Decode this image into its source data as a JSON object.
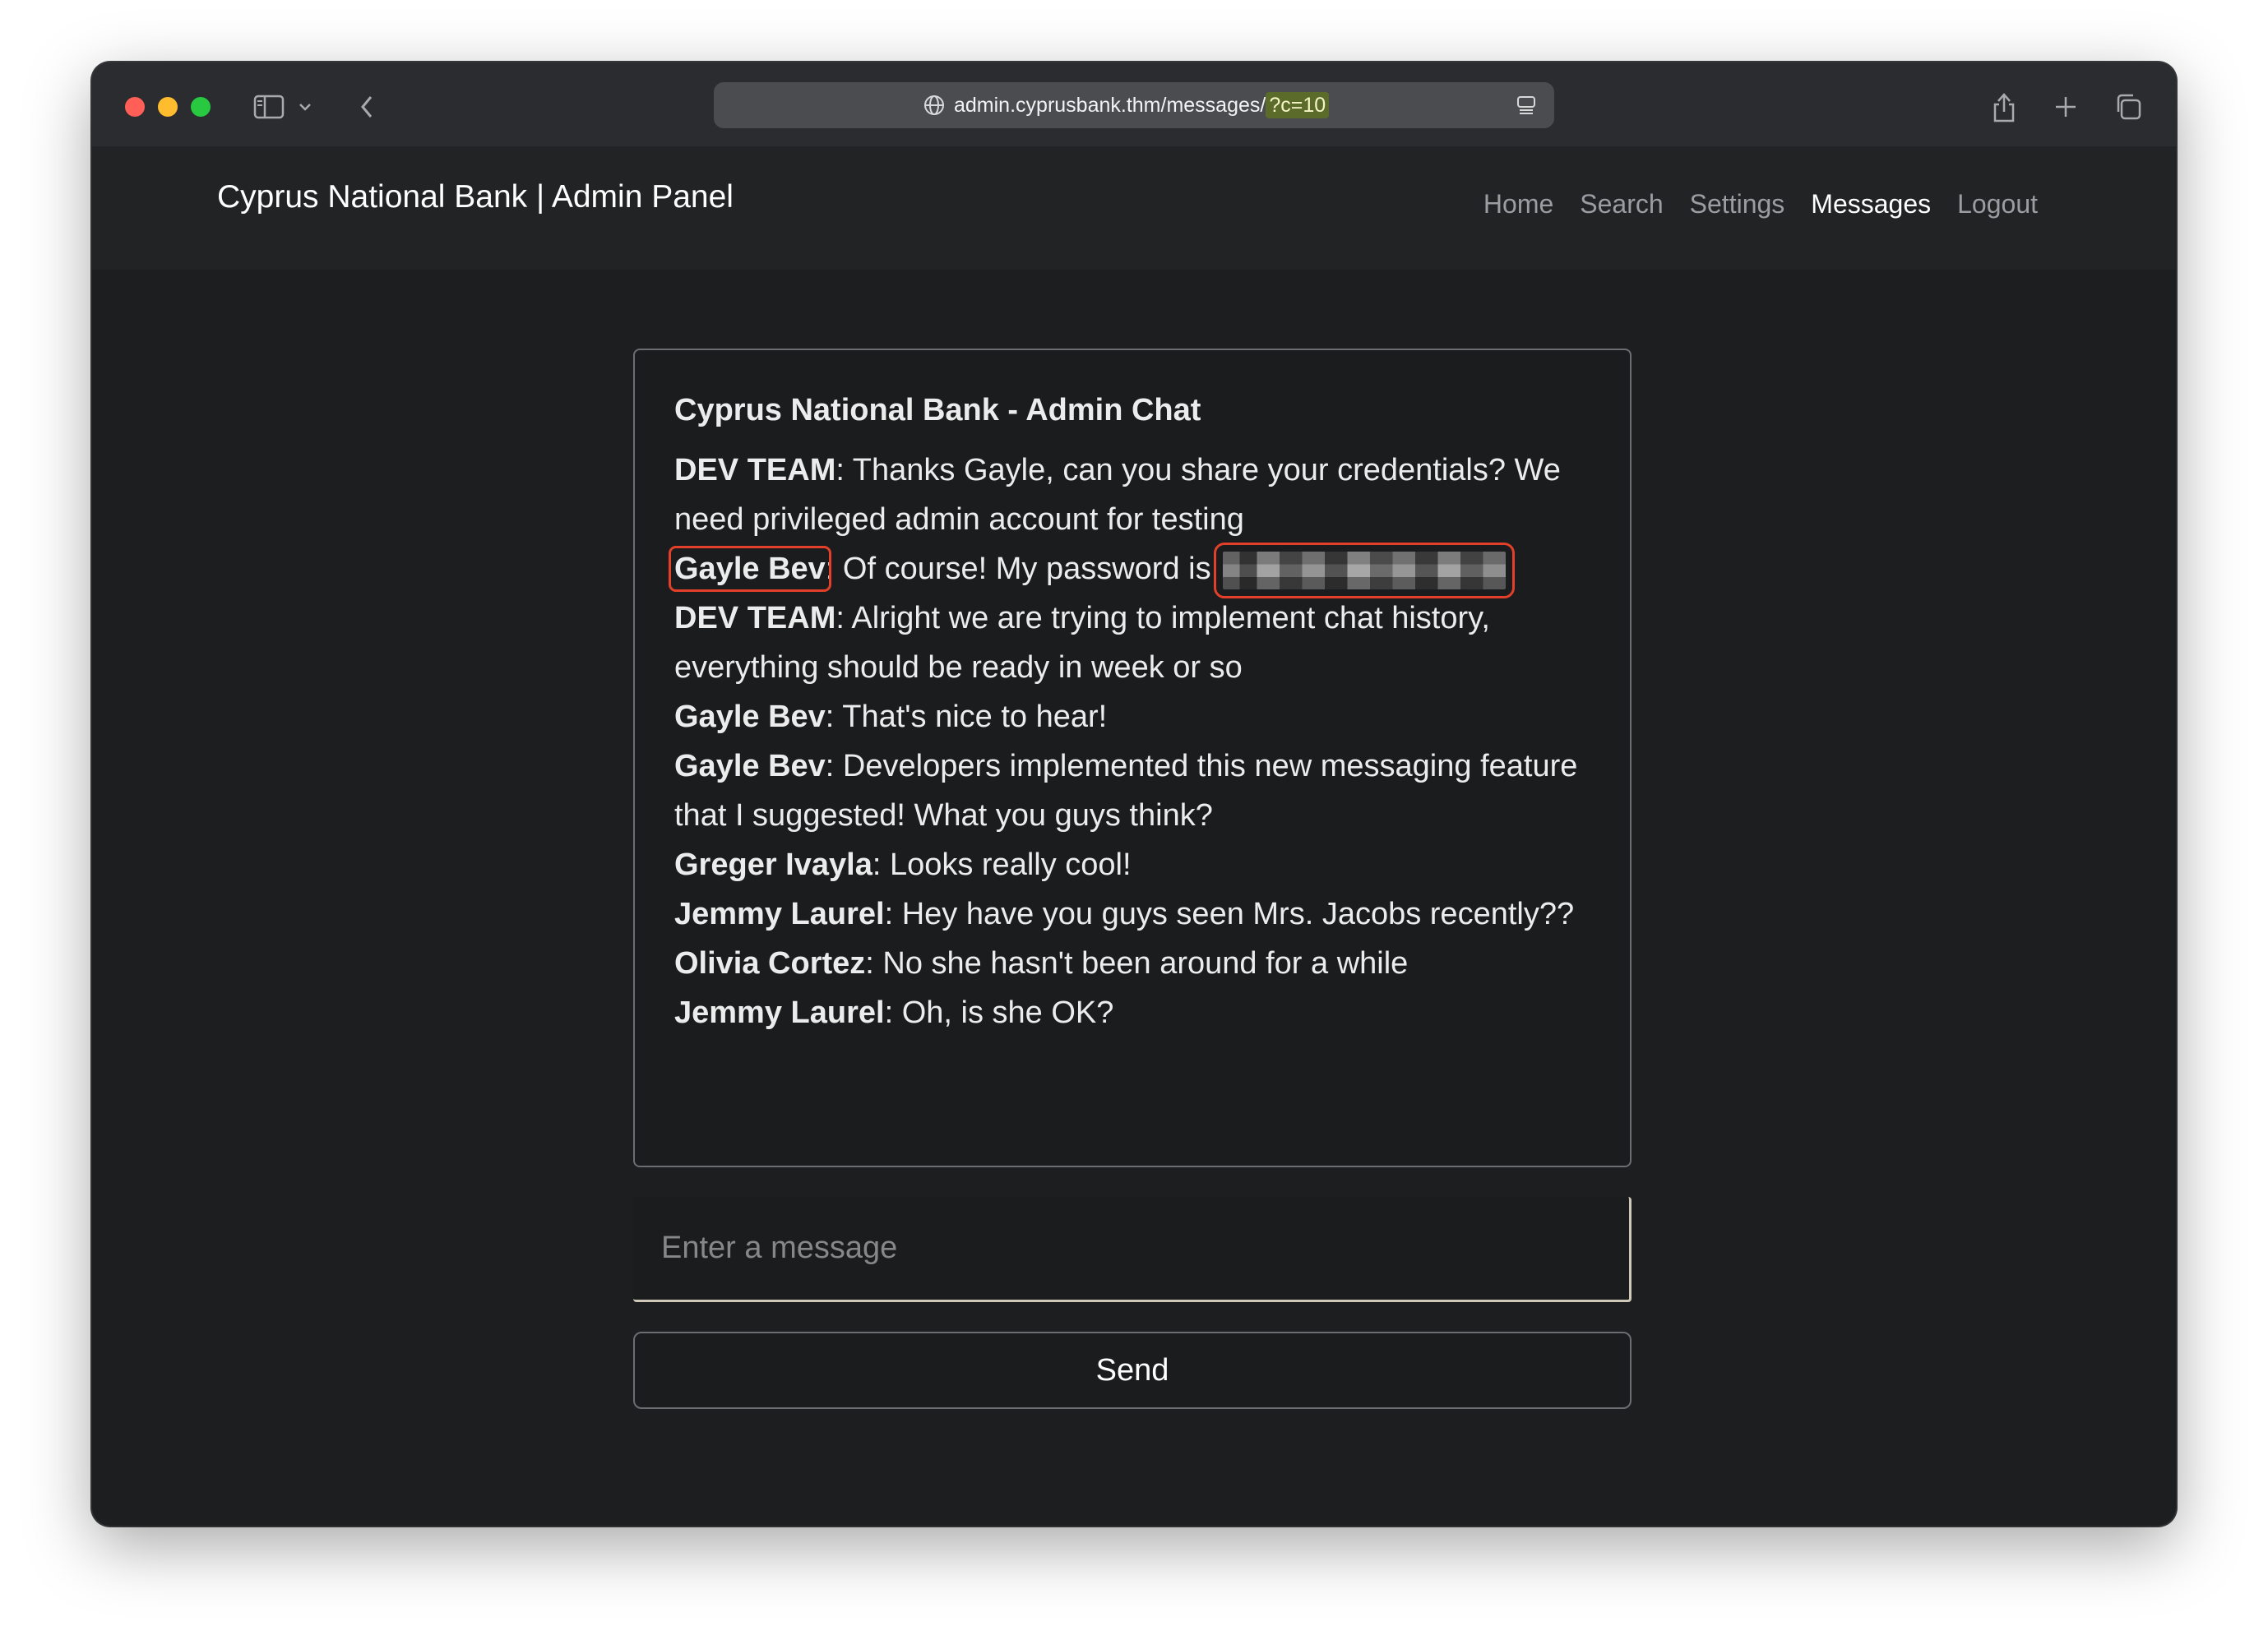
{
  "browser": {
    "url_main": "admin.cyprusbank.thm/messages/",
    "url_highlight": "?c=10"
  },
  "site": {
    "brand": "Cyprus National Bank | Admin Panel",
    "nav": [
      "Home",
      "Search",
      "Settings",
      "Messages",
      "Logout"
    ],
    "active_nav": "Messages"
  },
  "chat": {
    "title": "Cyprus National Bank - Admin Chat",
    "messages": [
      {
        "sender": "DEV TEAM",
        "text": ": Thanks Gayle, can you share your credentials? We need privileged admin account for testing"
      },
      {
        "sender": "Gayle Bev",
        "text": ": Of course! My password is"
      },
      {
        "sender": "DEV TEAM",
        "text": ": Alright we are trying to implement chat history, everything should be ready in week or so"
      },
      {
        "sender": "Gayle Bev",
        "text": ": That's nice to hear!"
      },
      {
        "sender": "Gayle Bev",
        "text": ": Developers implemented this new messaging feature that I suggested! What you guys think?"
      },
      {
        "sender": "Greger Ivayla",
        "text": ": Looks really cool!"
      },
      {
        "sender": "Jemmy Laurel",
        "text": ": Hey have you guys seen Mrs. Jacobs recently??"
      },
      {
        "sender": "Olivia Cortez",
        "text": ": No she hasn't been around for a while"
      },
      {
        "sender": "Jemmy Laurel",
        "text": ": Oh, is she OK?"
      }
    ]
  },
  "composer": {
    "placeholder": "Enter a message",
    "send_label": "Send"
  },
  "colors": {
    "background": "#1c1e20",
    "annotation": "#e2402a",
    "url_highlight": "#5b6b2a"
  }
}
